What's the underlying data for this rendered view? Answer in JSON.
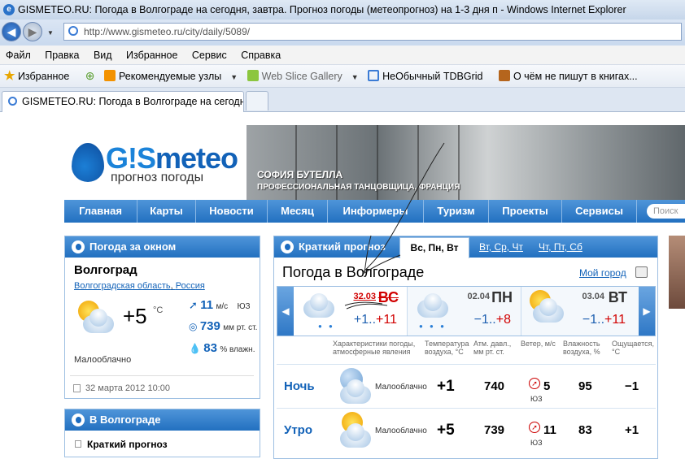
{
  "window": {
    "title": "GISMETEO.RU: Погода в Волгограде на сегодня, завтра. Прогноз погоды (метеопрогноз) на 1-3 дня п - Windows Internet Explorer"
  },
  "address": {
    "url": "http://www.gismeteo.ru/city/daily/5089/"
  },
  "menu": [
    "Файл",
    "Правка",
    "Вид",
    "Избранное",
    "Сервис",
    "Справка"
  ],
  "favorites": {
    "label": "Избранное",
    "items": [
      "Рекомендуемые узлы",
      "Web Slice Gallery",
      "НеОбычный TDBGrid",
      "О чём не пишут в книгах..."
    ]
  },
  "tab": {
    "title": "GISMETEO.RU: Погода в Волгограде на сегодня,..."
  },
  "site": {
    "logo_prefix": "G!S",
    "logo_main": "meteo",
    "logo_sub": "прогноз погоды",
    "banner_title": "СОФИЯ БУТЕЛЛА",
    "banner_sub": "ПРОФЕССИОНАЛЬНАЯ ТАНЦОВЩИЦА, ФРАНЦИЯ",
    "nav": [
      "Главная",
      "Карты",
      "Новости",
      "Месяц",
      "Информеры",
      "Туризм",
      "Проекты",
      "Сервисы"
    ],
    "search_placeholder": "Поиск"
  },
  "now": {
    "header": "Погода за окном",
    "city": "Волгоград",
    "region": "Волгоградская область",
    "country": "Россия",
    "temp": "+5",
    "temp_unit": "°C",
    "wind_value": "11",
    "wind_unit": "м/с",
    "wind_dir": "ЮЗ",
    "pressure_value": "739",
    "pressure_unit": "мм рт. ст.",
    "humidity_value": "83",
    "humidity_unit": "% влажн.",
    "condition": "Малооблачно",
    "date": "32 марта 2012 10:00"
  },
  "local": {
    "header": "В Волгограде",
    "item": "Краткий прогноз"
  },
  "forecast": {
    "header": "Краткий прогноз",
    "tabs": [
      "Вс, Пн, Вт",
      "Вт, Ср, Чт",
      "Чт, Пт, Сб"
    ],
    "title": "Погода в Волгограде",
    "my_city": "Мой город",
    "days": [
      {
        "date": "32.03",
        "name": "ВС",
        "t_min": "+1",
        "t_max": "+11"
      },
      {
        "date": "02.04",
        "name": "ПН",
        "t_min": "−1",
        "t_max": "+8"
      },
      {
        "date": "03.04",
        "name": "ВТ",
        "t_min": "−1",
        "t_max": "+11"
      }
    ],
    "range_sep": "..",
    "columns": [
      "Характеристики погоды, атмосферные явления",
      "Температура воздуха, °C",
      "Атм. давл., мм рт. ст.",
      "Ветер, м/с",
      "Влажность воздуха, %",
      "Ощущается, °C"
    ],
    "rows": [
      {
        "name": "Ночь",
        "cond": "Малооблачно",
        "temp": "+1",
        "pressure": "740",
        "wind": "5",
        "wind_dir": "ЮЗ",
        "humidity": "95",
        "feels": "−1"
      },
      {
        "name": "Утро",
        "cond": "Малооблачно",
        "temp": "+5",
        "pressure": "739",
        "wind": "11",
        "wind_dir": "ЮЗ",
        "humidity": "83",
        "feels": "+1"
      }
    ]
  },
  "colors": {
    "accent": "#2270c0",
    "link": "#1262b8",
    "warm": "#d10000"
  }
}
